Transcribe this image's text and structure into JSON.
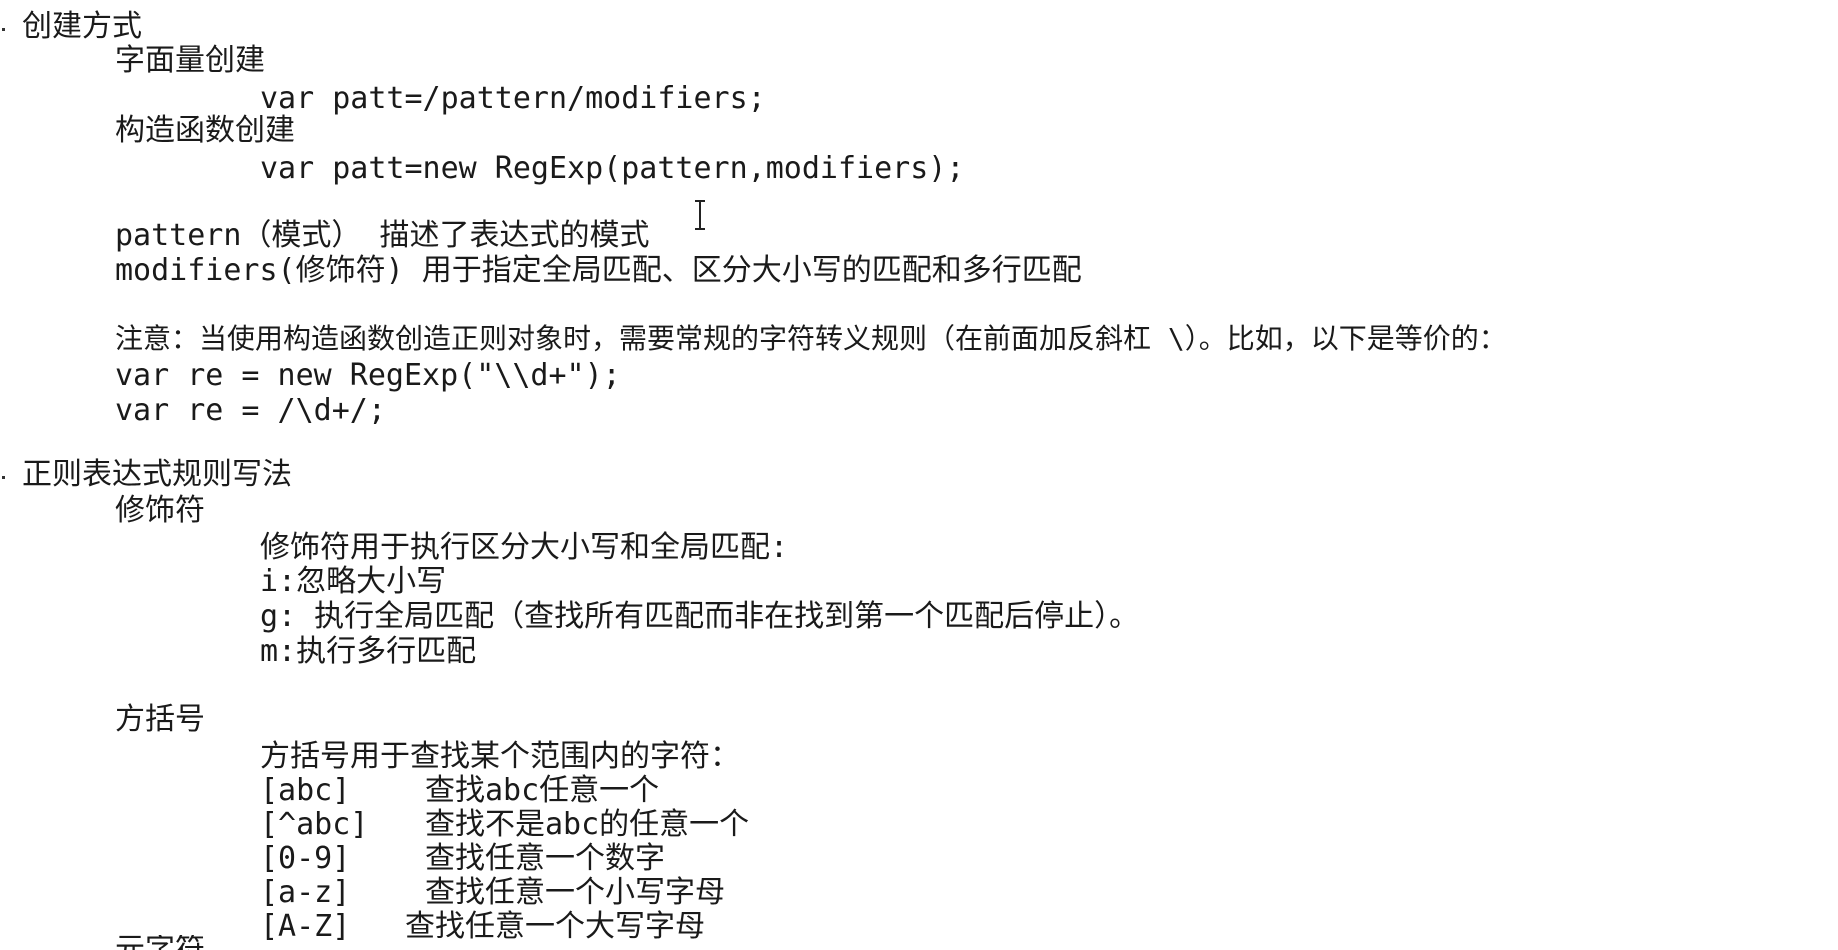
{
  "section1": {
    "heading": "创建方式",
    "literal_label": "字面量创建",
    "literal_code": "var patt=/pattern/modifiers;",
    "ctor_label": "构造函数创建",
    "ctor_code": "var patt=new RegExp(pattern,modifiers);",
    "pattern_desc": "pattern（模式） 描述了表达式的模式",
    "modifiers_desc": "modifiers(修饰符) 用于指定全局匹配、区分大小写的匹配和多行匹配",
    "note": "注意：当使用构造函数创造正则对象时，需要常规的字符转义规则（在前面加反斜杠 \\）。比如，以下是等价的：",
    "example1": "var re = new RegExp(\"\\\\d+\");",
    "example2": "var re = /\\d+/;"
  },
  "section2": {
    "heading": "正则表达式规则写法",
    "modifiers": {
      "label": "修饰符",
      "intro": "修饰符用于执行区分大小写和全局匹配:",
      "items": [
        "i:忽略大小写",
        "g: 执行全局匹配（查找所有匹配而非在找到第一个匹配后停止）。",
        "m:执行多行匹配"
      ]
    },
    "brackets": {
      "label": "方括号",
      "intro": "方括号用于查找某个范围内的字符：",
      "items": [
        {
          "expr": "[abc]",
          "desc": "查找abc任意一个"
        },
        {
          "expr": "[^abc]",
          "desc": "查找不是abc的任意一个"
        },
        {
          "expr": "[0-9]",
          "desc": "查找任意一个数字"
        },
        {
          "expr": "[a-z]",
          "desc": "查找任意一个小写字母"
        },
        {
          "expr": "[A-Z]",
          "desc": "查找任意一个大写字母"
        }
      ]
    },
    "next_label_partial": "元字符"
  },
  "icons": {
    "cursor": "text-cursor-icon"
  }
}
